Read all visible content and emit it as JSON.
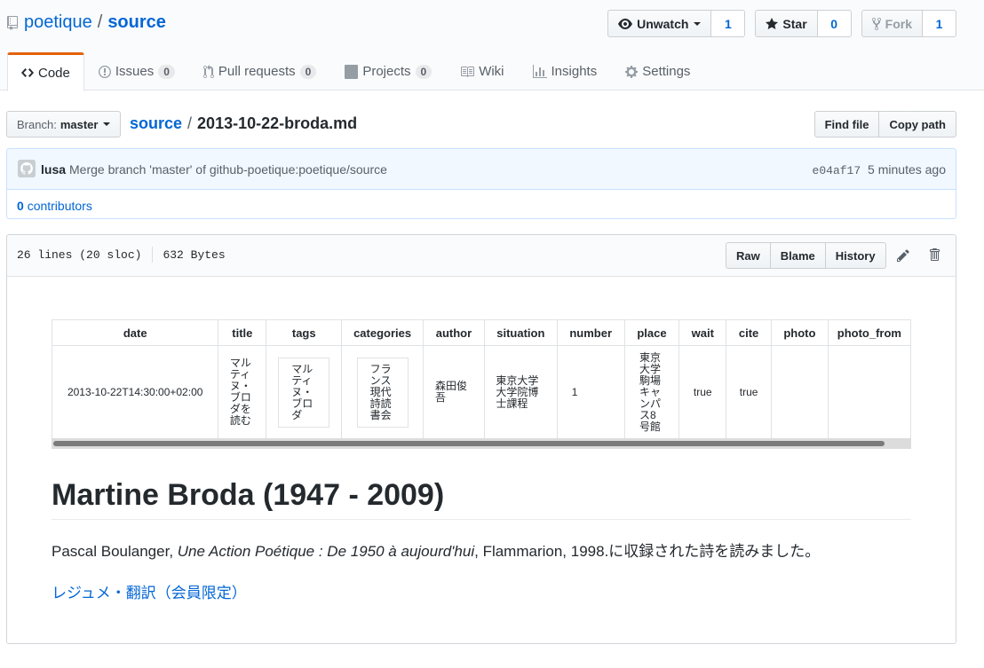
{
  "repo": {
    "owner": "poetique",
    "separator": "/",
    "name": "source"
  },
  "actions": {
    "watch_label": "Unwatch",
    "watch_count": "1",
    "star_label": "Star",
    "star_count": "0",
    "fork_label": "Fork",
    "fork_count": "1"
  },
  "nav": {
    "code": "Code",
    "issues": "Issues",
    "issues_count": "0",
    "pulls": "Pull requests",
    "pulls_count": "0",
    "projects": "Projects",
    "projects_count": "0",
    "wiki": "Wiki",
    "insights": "Insights",
    "settings": "Settings"
  },
  "file_nav": {
    "branch_label": "Branch:",
    "branch_name": "master",
    "breadcrumb_root": "source",
    "breadcrumb_sep": "/",
    "file_name": "2013-10-22-broda.md",
    "find_file": "Find file",
    "copy_path": "Copy path"
  },
  "commit": {
    "author": "lusa",
    "message": "Merge branch 'master' of github-poetique:poetique/source",
    "sha": "e04af17",
    "time": "5 minutes ago",
    "contributors_count": "0",
    "contributors_label": "contributors"
  },
  "file": {
    "lines": "26 lines (20 sloc)",
    "size": "632 Bytes",
    "raw": "Raw",
    "blame": "Blame",
    "history": "History"
  },
  "frontmatter": {
    "headers": [
      "date",
      "title",
      "tags",
      "categories",
      "author",
      "situation",
      "number",
      "place",
      "wait",
      "cite",
      "photo",
      "photo_from"
    ],
    "row": {
      "date": "2013-10-22T14:30:00+02:00",
      "title": "マルティヌ・ブロダを読む",
      "tags": "マルティヌ・ブロダ",
      "categories": "フランス現代詩読書会",
      "author": "森田俊吾",
      "situation": "東京大学大学院博士課程",
      "number": "1",
      "place": "東京大学駒場キャンパス8号館",
      "wait": "true",
      "cite": "true",
      "photo": "",
      "photo_from": ""
    }
  },
  "content": {
    "heading": "Martine Broda (1947 - 2009)",
    "para_author": "Pascal Boulanger, ",
    "para_title": "Une Action Poétique : De 1950 à aujourd'hui",
    "para_rest": ", Flammarion, 1998.に収録された詩を読みました。",
    "link": "レジュメ・翻訳（会員限定）"
  }
}
